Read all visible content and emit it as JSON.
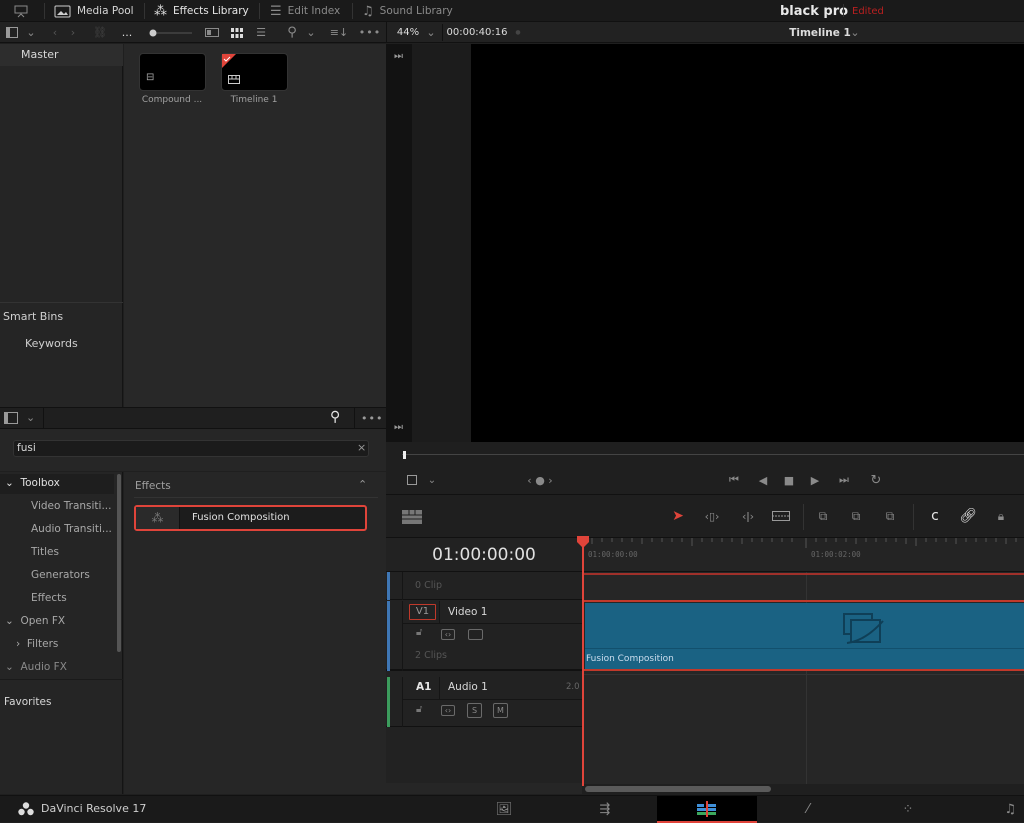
{
  "topbar": {
    "tabs": [
      {
        "label": "Media Pool",
        "icon": "media-pool-icon"
      },
      {
        "label": "Effects Library",
        "icon": "magic-wand-icon"
      },
      {
        "label": "Edit Index",
        "icon": "list-icon"
      },
      {
        "label": "Sound Library",
        "icon": "music-icon"
      }
    ],
    "project_title": "black pro",
    "project_status": "Edited"
  },
  "toolbar": {
    "ellipsis": "...",
    "zoom": "44%",
    "timecode": "00:00:40:16",
    "timeline_name": "Timeline 1"
  },
  "media_pool": {
    "bins": {
      "master": "Master",
      "smart_bins": "Smart Bins",
      "keywords": "Keywords"
    },
    "clips": [
      {
        "label": "Compound ...",
        "type": "compound-clip"
      },
      {
        "label": "Timeline 1",
        "type": "timeline"
      }
    ]
  },
  "effects_library": {
    "search_value": "fusi",
    "tree": [
      {
        "label": "Toolbox",
        "expanded": true
      },
      {
        "label": "Video Transiti..."
      },
      {
        "label": "Audio Transiti..."
      },
      {
        "label": "Titles"
      },
      {
        "label": "Generators"
      },
      {
        "label": "Effects"
      },
      {
        "label": "Open FX",
        "expanded": true
      },
      {
        "label": "Filters",
        "expanded": false
      },
      {
        "label": "Audio FX",
        "expanded": true
      }
    ],
    "favorites": "Favorites",
    "section_title": "Effects",
    "results": [
      {
        "label": "Fusion Composition"
      }
    ]
  },
  "timeline": {
    "timecode": "01:00:00:00",
    "ruler_labels": [
      "01:00:00:00",
      "01:00:02:00"
    ],
    "tracks": {
      "v2_info": "0 Clip",
      "v1": {
        "id": "V1",
        "name": "Video 1",
        "clips": "2 Clips"
      },
      "a1": {
        "id": "A1",
        "name": "Audio 1",
        "channels": "2.0",
        "solo": "S",
        "mute": "M"
      }
    },
    "clip_name": "Fusion Composition"
  },
  "footer": {
    "app_name": "DaVinci Resolve 17",
    "pages": [
      "media",
      "cut",
      "edit",
      "fusion",
      "color",
      "fairlight"
    ],
    "active_page": "edit"
  },
  "colors": {
    "accent_red": "#e0443a",
    "clip_blue": "#1a6283",
    "video_track": "#3f77b5",
    "audio_track": "#3c9c5d"
  }
}
